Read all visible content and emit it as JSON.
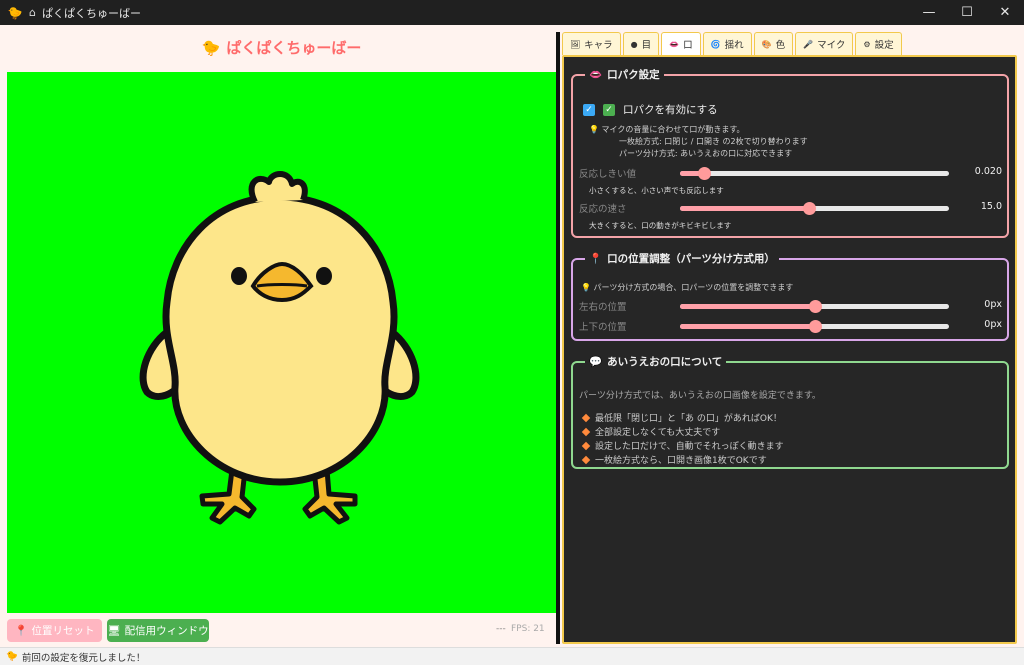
{
  "window": {
    "title": "ぱくぱくちゅーばー",
    "minimize": "—",
    "maximize": "☐",
    "close": "✕"
  },
  "left": {
    "app_title": "ぱくぱくちゅーばー",
    "reset_button": "位置リセット",
    "stream_window_button": "配信用ウィンドウ",
    "mute_indicator": "---",
    "fps": "FPS: 21"
  },
  "status_bar": "前回の設定を復元しました！",
  "tabs": [
    {
      "label": "キャラ",
      "icon": "picture-icon"
    },
    {
      "label": "目",
      "icon": "eye-icon"
    },
    {
      "label": "口",
      "icon": "lips-icon",
      "active": true
    },
    {
      "label": "揺れ",
      "icon": "wave-icon"
    },
    {
      "label": "色",
      "icon": "palette-icon"
    },
    {
      "label": "マイク",
      "icon": "mic-icon"
    },
    {
      "label": "設定",
      "icon": "gear-icon"
    }
  ],
  "lipsync": {
    "title": "口パク設定",
    "enable_label": "口パクを有効にする",
    "enabled": true,
    "hint_lines": [
      "マイクの音量に合わせて口が動きます。",
      "一枚絵方式: 口閉じ / 口開き の2枚で切り替わります",
      "パーツ分け方式: あいうえおの口に対応できます"
    ],
    "threshold": {
      "label": "反応しきい値",
      "value": 0.02,
      "display": "0.020",
      "ratio": 0.09,
      "hint": "小さくすると、小さい声でも反応します"
    },
    "speed": {
      "label": "反応の速さ",
      "value": 15.0,
      "display": "15.0",
      "ratio": 0.48,
      "hint": "大きくすると、口の動きがキビキビします"
    }
  },
  "mouth_position": {
    "title": "口の位置調整（パーツ分け方式用）",
    "hint": "パーツ分け方式の場合、口パーツの位置を調整できます",
    "horizontal": {
      "label": "左右の位置",
      "value": 0,
      "display": "0px",
      "ratio": 0.5
    },
    "vertical": {
      "label": "上下の位置",
      "value": 0,
      "display": "0px",
      "ratio": 0.5
    }
  },
  "aiueo": {
    "title": "あいうえおの口について",
    "intro": "パーツ分け方式では、あいうえおの口画像を設定できます。",
    "bullets": [
      "最低限「閉じ口」と「あ の口」があればOK！",
      "全部設定しなくても大丈夫です",
      "設定した口だけで、自動でそれっぽく動きます",
      "一枚絵方式なら、口開き画像1枚でOKです"
    ]
  },
  "colors": {
    "canvas_bg": "#00ff00",
    "accent_pink": "#ff6b6b",
    "slider": "#ff9b9b",
    "tab_border": "#f2c94c"
  }
}
